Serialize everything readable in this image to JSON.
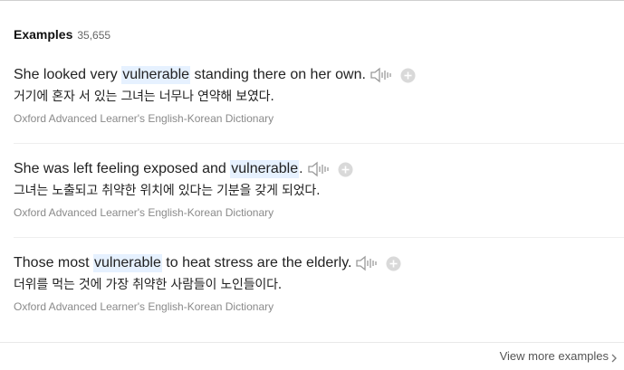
{
  "section": {
    "title": "Examples",
    "count": "35,655"
  },
  "examples": [
    {
      "before": "She looked very ",
      "keyword": "vulnerable",
      "after": " standing there on her own.",
      "translation": "거기에 혼자 서 있는 그녀는 너무나 연약해 보였다.",
      "source": "Oxford Advanced Learner's English-Korean Dictionary"
    },
    {
      "before": "She was left feeling exposed and ",
      "keyword": "vulnerable",
      "after": ".",
      "translation": "그녀는 노출되고 취약한 위치에 있다는 기분을 갖게 되었다.",
      "source": "Oxford Advanced Learner's English-Korean Dictionary"
    },
    {
      "before": "Those most ",
      "keyword": "vulnerable",
      "after": " to heat stress are the elderly.",
      "translation": "더위를 먹는 것에 가장 취약한 사람들이 노인들이다.",
      "source": "Oxford Advanced Learner's English-Korean Dictionary"
    }
  ],
  "footer": {
    "view_more_label": "View more examples"
  },
  "icons": {
    "speaker": "speaker-icon",
    "add": "plus-circle-icon",
    "chevron": "chevron-right-icon"
  },
  "colors": {
    "highlight": "#e6f1ff",
    "icon_gray": "#9a9a9a"
  }
}
